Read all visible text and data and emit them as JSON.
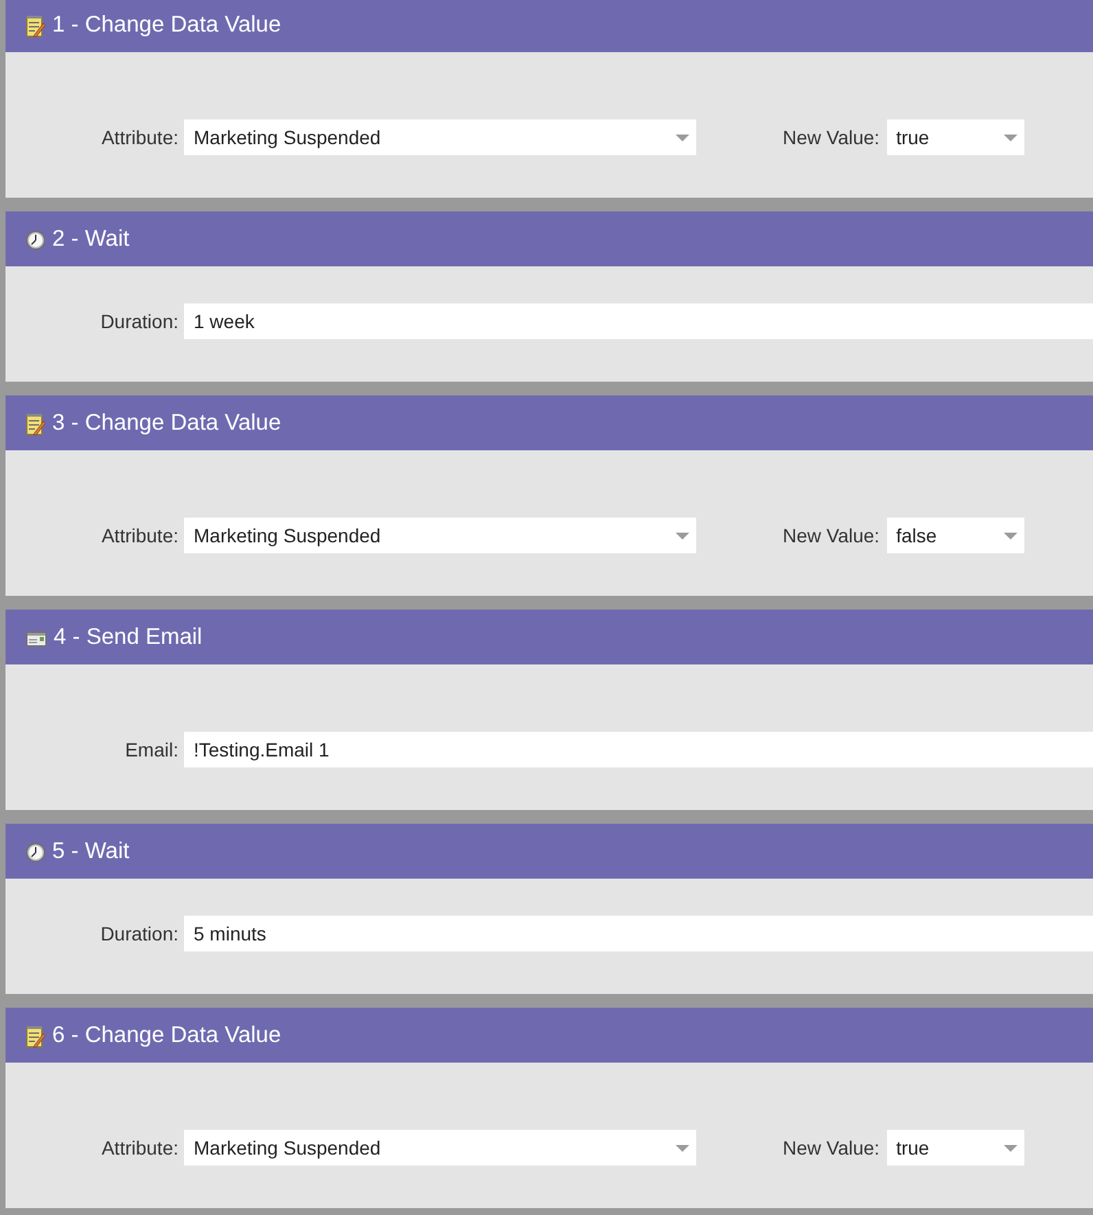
{
  "steps": [
    {
      "kind": "change_data",
      "title": "1 - Change Data Value",
      "fields": [
        {
          "kind": "dropdown",
          "label": "Attribute:",
          "value": "Marketing Suspended"
        },
        {
          "kind": "dropdown",
          "label": "New Value:",
          "value": "true"
        }
      ]
    },
    {
      "kind": "wait",
      "title": "2 - Wait",
      "fields": [
        {
          "kind": "text",
          "label": "Duration:",
          "value": "1 week"
        }
      ]
    },
    {
      "kind": "change_data",
      "title": "3 - Change Data Value",
      "fields": [
        {
          "kind": "dropdown",
          "label": "Attribute:",
          "value": "Marketing Suspended"
        },
        {
          "kind": "dropdown",
          "label": "New Value:",
          "value": "false"
        }
      ]
    },
    {
      "kind": "send_email",
      "title": "4 - Send Email",
      "fields": [
        {
          "kind": "text",
          "label": "Email:",
          "value": "!Testing.Email 1"
        }
      ]
    },
    {
      "kind": "wait",
      "title": "5 - Wait",
      "fields": [
        {
          "kind": "text",
          "label": "Duration:",
          "value": "5 minuts"
        }
      ]
    },
    {
      "kind": "change_data",
      "title": "6 - Change Data Value",
      "fields": [
        {
          "kind": "dropdown",
          "label": "Attribute:",
          "value": "Marketing Suspended"
        },
        {
          "kind": "dropdown",
          "label": "New Value:",
          "value": "true"
        }
      ]
    }
  ]
}
